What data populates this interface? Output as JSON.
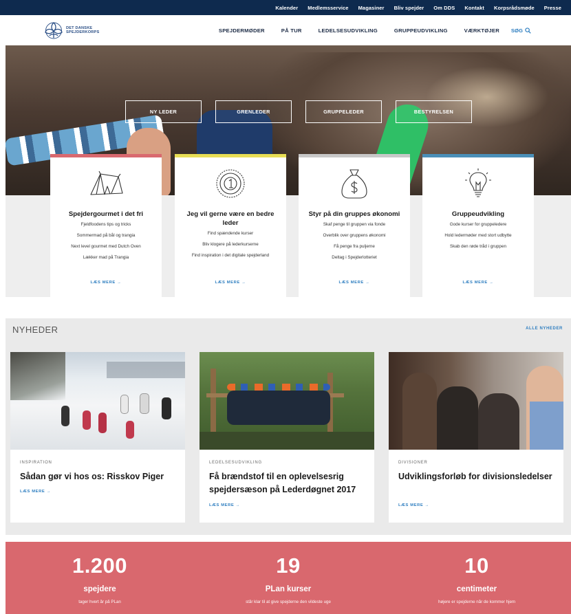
{
  "topbar": {
    "links": [
      "Kalender",
      "Medlemsservice",
      "Magasiner",
      "Bliv spejder",
      "Om DDS",
      "Kontakt",
      "Korpsrådsmøde",
      "Presse"
    ]
  },
  "header": {
    "logo_text_1": "DET DANSKE",
    "logo_text_2": "SPEJDERKORPS",
    "nav": [
      "SPEJDERMØDER",
      "PÅ TUR",
      "LEDELSESUDVIKLING",
      "GRUPPEUDVIKLING",
      "VÆRKTØJER"
    ],
    "search_label": "SØG"
  },
  "hero": {
    "roles": [
      "NY LEDER",
      "GRENLEDER",
      "GRUPPELEDER",
      "BESTYRELSEN"
    ]
  },
  "cards": [
    {
      "title": "Spejdergourmet i det fri",
      "icon": "tent-icon",
      "color": "#d9696f",
      "lines": [
        "Fjeldfoodens tips og tricks",
        "Sommermad på bål og trangia",
        "Next level gourmet med Dutch Oven",
        "Lækker mad på Trangia"
      ],
      "more": "LÆS MERE →"
    },
    {
      "title": "Jeg vil gerne være en bedre leder",
      "icon": "medal-icon",
      "color": "#e8de55",
      "lines": [
        "Find spændende kurser",
        "Bliv klogere på lederkurserne",
        "Find inspiration i det digitale spejderland"
      ],
      "more": "LÆS MERE →"
    },
    {
      "title": "Styr på din gruppes økonomi",
      "icon": "money-bag-icon",
      "color": "#c8c8c8",
      "lines": [
        "Skaf penge til gruppen via fonde",
        "Overblik over gruppens økonomi",
        "Få penge fra puljerne",
        "Deltag i Spejderlotteriet"
      ],
      "more": "LÆS MERE →"
    },
    {
      "title": "Gruppeudvikling",
      "icon": "lightbulb-icon",
      "color": "#4a8fb8",
      "lines": [
        "Gode kurser for gruppeledere",
        "Hold ledermøder med stort udbytte",
        "Skab den røde tråd i gruppen"
      ],
      "more": "LÆS MERE →"
    }
  ],
  "news": {
    "title": "NYHEDER",
    "all_link": "ALLE NYHEDER",
    "items": [
      {
        "category": "INSPIRATION",
        "title": "Sådan gør vi hos os: Risskov Piger",
        "more": "LÆS MERE →"
      },
      {
        "category": "LEDELSESUDVIKLING",
        "title": "Få brændstof til en oplevelsesrig spejdersæson på Lederdøgnet 2017",
        "more": "LÆS MERE →"
      },
      {
        "category": "DIVISIONER",
        "title": "Udviklingsforløb for divisionsledelser",
        "more": "LÆS MERE →"
      }
    ]
  },
  "stats": [
    {
      "number": "1.200",
      "unit": "spejdere",
      "desc": "tager hvert år på PLan"
    },
    {
      "number": "19",
      "unit": "PLan kurser",
      "desc": "står klar til at give spejderne den vildeste uge"
    },
    {
      "number": "10",
      "unit": "centimeter",
      "desc": "højere er spejderne når de kommer hjem"
    }
  ],
  "colors": {
    "topbar": "#0e2a4e",
    "accent_blue": "#2e7ec0",
    "stats_bg": "#d9686e"
  }
}
